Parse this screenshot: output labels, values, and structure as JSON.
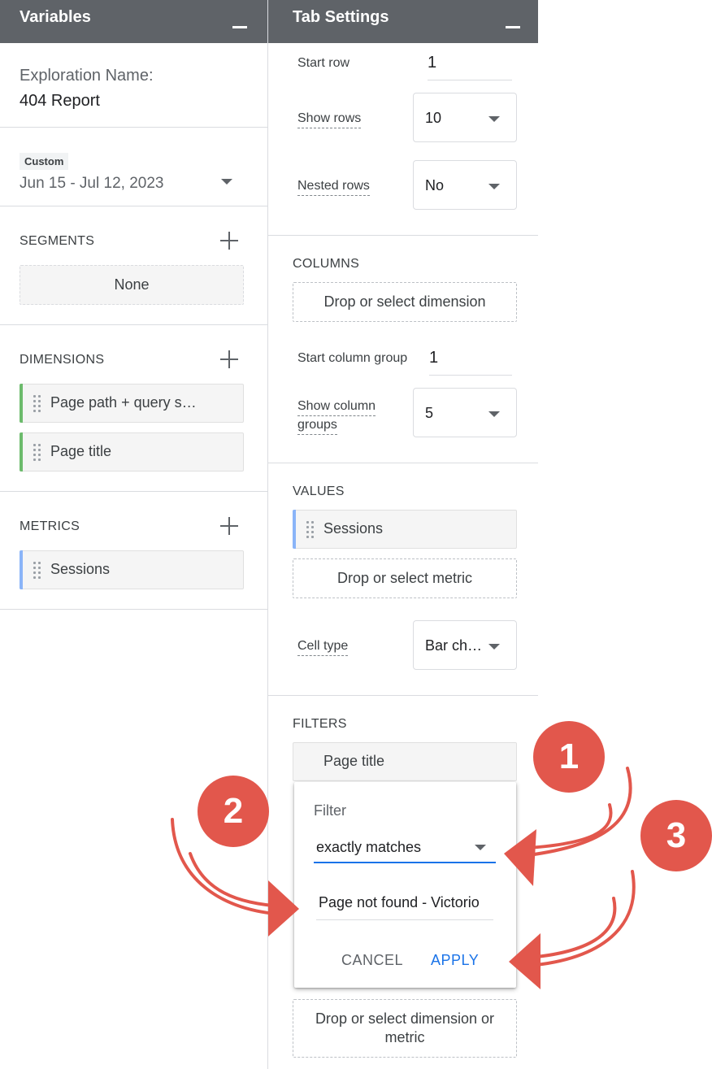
{
  "variables_panel": {
    "title": "Variables",
    "exploration_name_label": "Exploration Name:",
    "exploration_name_value": "404 Report",
    "date_range": {
      "badge": "Custom",
      "value": "Jun 15 - Jul 12, 2023"
    },
    "segments": {
      "label": "SEGMENTS",
      "empty_label": "None"
    },
    "dimensions": {
      "label": "DIMENSIONS",
      "items": [
        "Page path + query s…",
        "Page title"
      ]
    },
    "metrics": {
      "label": "METRICS",
      "items": [
        "Sessions"
      ]
    }
  },
  "tab_settings_panel": {
    "title": "Tab Settings",
    "start_row_label": "Start row",
    "start_row_value": "1",
    "show_rows_label": "Show rows",
    "show_rows_value": "10",
    "nested_rows_label": "Nested rows",
    "nested_rows_value": "No",
    "columns": {
      "label": "COLUMNS",
      "drop_placeholder": "Drop or select dimension",
      "start_group_label": "Start column group",
      "start_group_value": "1",
      "show_groups_label_line1": "Show column",
      "show_groups_label_line2": "groups",
      "show_groups_value": "5"
    },
    "values": {
      "label": "VALUES",
      "items": [
        "Sessions"
      ],
      "drop_placeholder": "Drop or select metric",
      "cell_type_label": "Cell type",
      "cell_type_value": "Bar ch…"
    },
    "filters": {
      "label": "FILTERS",
      "item": "Page title",
      "popup": {
        "title": "Filter",
        "match_type": "exactly matches",
        "match_value": "Page not found - Victorio",
        "cancel": "CANCEL",
        "apply": "APPLY"
      },
      "drop_placeholder_line1": "Drop or select dimension or",
      "drop_placeholder_line2": "metric"
    }
  },
  "annotations": {
    "badges": [
      "1",
      "2",
      "3"
    ],
    "color": "#e2574c"
  },
  "colors": {
    "header_bg": "#5f6368",
    "dimension_accent": "#6cbb6c",
    "metric_accent": "#8ab4f8",
    "apply_blue": "#1a73e8"
  }
}
